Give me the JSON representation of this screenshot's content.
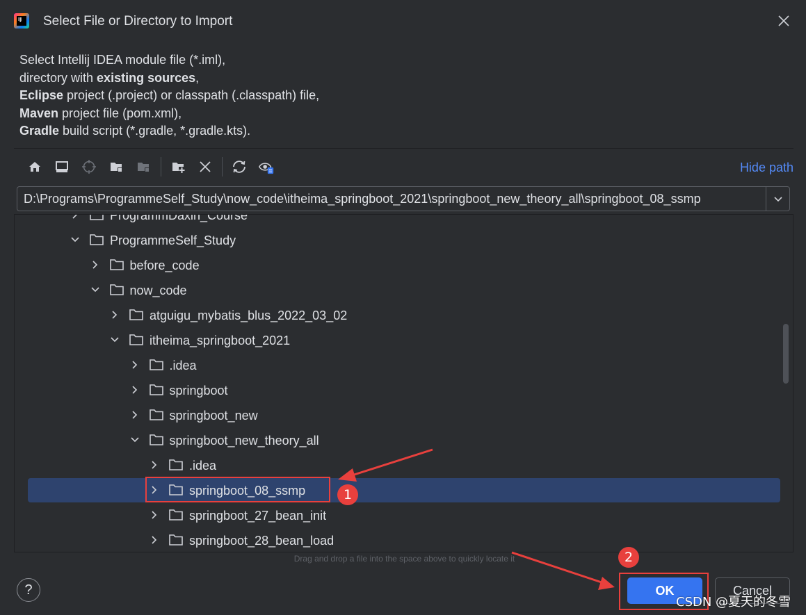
{
  "window": {
    "title": "Select File or Directory to Import",
    "logo_text": "IJ"
  },
  "description": {
    "line1": "Select Intellij IDEA module file (*.iml),",
    "line2_prefix": "directory with ",
    "line2_bold": "existing sources",
    "line2_suffix": ",",
    "line3_bold": "Eclipse",
    "line3_rest": " project (.project) or classpath (.classpath) file,",
    "line4_bold": "Maven",
    "line4_rest": " project file (pom.xml),",
    "line5_bold": "Gradle",
    "line5_rest": " build script (*.gradle, *.gradle.kts)."
  },
  "toolbar": {
    "icons": [
      "home-icon",
      "desktop-icon",
      "locate-icon",
      "new-folder-icon",
      "folder-disabled-icon",
      "add-folder-icon",
      "delete-icon",
      "refresh-icon",
      "show-hidden-icon"
    ],
    "hide_path_label": "Hide path"
  },
  "path_field": {
    "value": "D:\\Programs\\ProgrammeSelf_Study\\now_code\\itheima_springboot_2021\\springboot_new_theory_all\\springboot_08_ssmp"
  },
  "tree": {
    "rows": [
      {
        "label": "ProgrammDaxin_Course",
        "expanded": false,
        "level": 0,
        "selected": false
      },
      {
        "label": "ProgrammeSelf_Study",
        "expanded": true,
        "level": 0,
        "selected": false
      },
      {
        "label": "before_code",
        "expanded": false,
        "level": 1,
        "selected": false
      },
      {
        "label": "now_code",
        "expanded": true,
        "level": 1,
        "selected": false
      },
      {
        "label": "atguigu_mybatis_blus_2022_03_02",
        "expanded": false,
        "level": 2,
        "selected": false
      },
      {
        "label": "itheima_springboot_2021",
        "expanded": true,
        "level": 2,
        "selected": false
      },
      {
        "label": ".idea",
        "expanded": false,
        "level": 3,
        "selected": false
      },
      {
        "label": "springboot",
        "expanded": false,
        "level": 3,
        "selected": false
      },
      {
        "label": "springboot_new",
        "expanded": false,
        "level": 3,
        "selected": false
      },
      {
        "label": "springboot_new_theory_all",
        "expanded": true,
        "level": 3,
        "selected": false
      },
      {
        "label": ".idea",
        "expanded": false,
        "level": 4,
        "selected": false
      },
      {
        "label": "springboot_08_ssmp",
        "expanded": false,
        "level": 4,
        "selected": true
      },
      {
        "label": "springboot_27_bean_init",
        "expanded": false,
        "level": 4,
        "selected": false
      },
      {
        "label": "springboot_28_bean_load",
        "expanded": false,
        "level": 4,
        "selected": false
      }
    ]
  },
  "drag_hint": "Drag and drop a file into the space above to quickly locate it",
  "buttons": {
    "help": "?",
    "ok": "OK",
    "cancel": "Cancel"
  },
  "annotations": {
    "marker1": "1",
    "marker2": "2",
    "color": "#e8403d"
  },
  "watermark": "CSDN @夏天的冬雪",
  "colors": {
    "background": "#2b2d30",
    "selection": "#2e436e",
    "accent": "#3574f0",
    "link": "#548af7"
  }
}
